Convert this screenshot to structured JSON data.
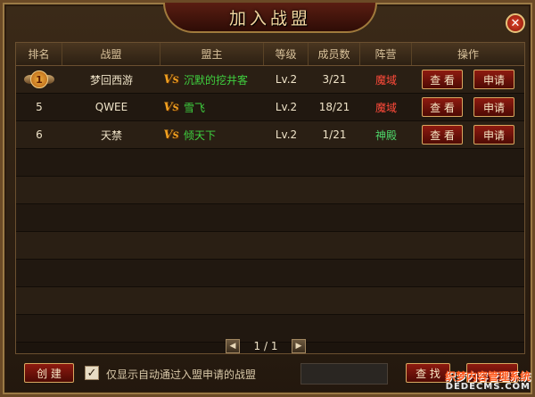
{
  "dialog": {
    "title": "加入战盟",
    "close_icon": "close-icon"
  },
  "table": {
    "headers": [
      "排名",
      "战盟",
      "盟主",
      "等级",
      "成员数",
      "阵营",
      "操作"
    ],
    "rows": [
      {
        "rank": "1",
        "rank_icon": "medal-icon",
        "name": "梦回西游",
        "leader": "沉默的挖井客",
        "level": "Lv.2",
        "members": "3/21",
        "camp": "魔域",
        "camp_color": "#ff4a3a",
        "view_label": "查 看",
        "apply_label": "申请"
      },
      {
        "rank": "5",
        "name": "QWEE",
        "leader": "雪飞",
        "level": "Lv.2",
        "members": "18/21",
        "camp": "魔域",
        "camp_color": "#ff4a3a",
        "view_label": "查 看",
        "apply_label": "申请"
      },
      {
        "rank": "6",
        "name": "天禁",
        "leader": "倾天下",
        "level": "Lv.2",
        "members": "1/21",
        "camp": "神殿",
        "camp_color": "#4ed86a",
        "view_label": "查 看",
        "apply_label": "申请"
      }
    ],
    "vs_icon_text": "VS"
  },
  "pager": {
    "prev_icon": "triangle-left-icon",
    "next_icon": "triangle-right-icon",
    "text": "1 / 1"
  },
  "footer": {
    "create_label": "创 建",
    "checkbox_checked": true,
    "checkbox_label": "仅显示自动通过入盟申请的战盟",
    "search_value": "",
    "search_label": "查 找"
  },
  "watermark": {
    "line1": "织梦内容管理系统",
    "line2": "DEDECMS.COM"
  },
  "colors": {
    "accent_red": "#8e1a10",
    "gold_border": "#d9a860",
    "leader_green": "#3fd03f"
  }
}
